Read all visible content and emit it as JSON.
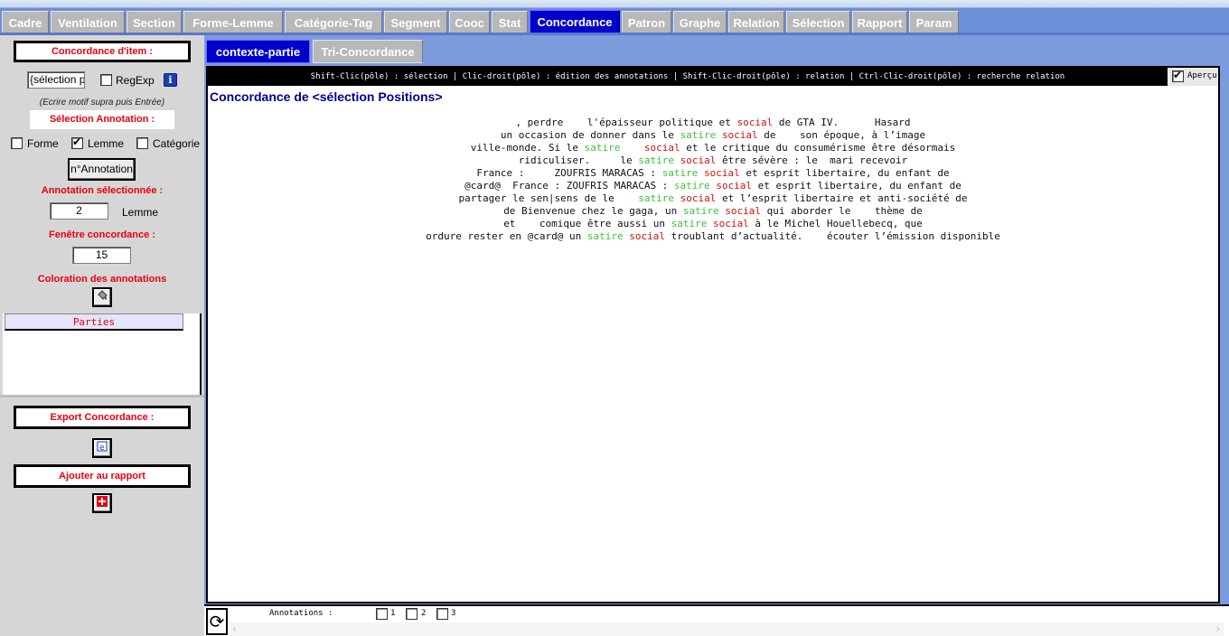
{
  "tabs": [
    {
      "label": "Cadre",
      "active": false
    },
    {
      "label": "Ventilation",
      "active": false
    },
    {
      "label": "Section",
      "active": false
    },
    {
      "label": "Forme-Lemme",
      "active": false
    },
    {
      "label": "Catégorie-Tag",
      "active": false
    },
    {
      "label": "Segment",
      "active": false
    },
    {
      "label": "Cooc",
      "active": false
    },
    {
      "label": "Stat",
      "active": false
    },
    {
      "label": "Concordance",
      "active": true
    },
    {
      "label": "Patron",
      "active": false
    },
    {
      "label": "Graphe",
      "active": false
    },
    {
      "label": "Relation",
      "active": false
    },
    {
      "label": "Sélection",
      "active": false
    },
    {
      "label": "Rapport",
      "active": false
    },
    {
      "label": "Param",
      "active": false
    }
  ],
  "left_panel": {
    "concordance_item_label": "Concordance d'item :",
    "search_value": "{sélection po",
    "regexp_label": "RegExp",
    "regexp_checked": false,
    "info_icon": "i",
    "hint": "(Ecrire motif supra puis Entrée)",
    "selection_annotation_label": "Sélection Annotation :",
    "annotation_types": [
      {
        "label": "Forme",
        "checked": false
      },
      {
        "label": "Lemme",
        "checked": true
      },
      {
        "label": "Catégorie",
        "checked": false
      }
    ],
    "n_annotation_button": "n°Annotation",
    "annotation_selected_label": "Annotation sélectionnée :",
    "annotation_selected_value": "2",
    "annotation_selected_name": "Lemme",
    "window_label": "Fenêtre concordance :",
    "window_value": "15",
    "coloring_label": "Coloration des annotations",
    "parties_header": "Parties",
    "export_label": "Export Concordance :",
    "add_report_label": "Ajouter au rapport"
  },
  "subtabs": [
    {
      "label": "contexte-partie",
      "active": true
    },
    {
      "label": "Tri-Concordance",
      "active": false
    }
  ],
  "content": {
    "instructions": "Shift-Clic(pôle) : sélection | Clic-droit(pôle) : édition des annotations | Shift-Clic-droit(pôle) : relation | Ctrl-Clic-droit(pôle) : recherche relation",
    "apercu_label": "Aperçu",
    "apercu_checked": true,
    "title": "Concordance de <sélection Positions>",
    "lines": [
      [
        {
          "t": ", perdre    l'épaisseur politique et ",
          "c": "n"
        },
        {
          "t": "social",
          "c": "k"
        },
        {
          "t": " de GTA IV.      Hasard",
          "c": "n"
        }
      ],
      [
        {
          "t": "un occasion de donner dans le ",
          "c": "n"
        },
        {
          "t": "satire",
          "c": "p"
        },
        {
          "t": " ",
          "c": "n"
        },
        {
          "t": "social",
          "c": "k"
        },
        {
          "t": " de    son époque, à l’image",
          "c": "n"
        }
      ],
      [
        {
          "t": "ville-monde. Si le ",
          "c": "n"
        },
        {
          "t": "satire",
          "c": "p"
        },
        {
          "t": "    ",
          "c": "n"
        },
        {
          "t": "social",
          "c": "k"
        },
        {
          "t": " et le critique du consumérisme être désormais",
          "c": "n"
        }
      ],
      [
        {
          "t": "ridiculiser.     le ",
          "c": "n"
        },
        {
          "t": "satire",
          "c": "p"
        },
        {
          "t": " ",
          "c": "n"
        },
        {
          "t": "social",
          "c": "k"
        },
        {
          "t": " être sévère : le  mari recevoir",
          "c": "n"
        }
      ],
      [
        {
          "t": "France :     ZOUFRIS MARACAS : ",
          "c": "n"
        },
        {
          "t": "satire",
          "c": "p"
        },
        {
          "t": " ",
          "c": "n"
        },
        {
          "t": "social",
          "c": "k"
        },
        {
          "t": " et esprit libertaire, du enfant de",
          "c": "n"
        }
      ],
      [
        {
          "t": "@card@  France : ZOUFRIS MARACAS : ",
          "c": "n"
        },
        {
          "t": "satire",
          "c": "p"
        },
        {
          "t": " ",
          "c": "n"
        },
        {
          "t": "social",
          "c": "k"
        },
        {
          "t": " et esprit libertaire, du enfant de",
          "c": "n"
        }
      ],
      [
        {
          "t": "partager le sen|sens de le    ",
          "c": "n"
        },
        {
          "t": "satire",
          "c": "p"
        },
        {
          "t": " ",
          "c": "n"
        },
        {
          "t": "social",
          "c": "k"
        },
        {
          "t": " et l’esprit libertaire et anti-société de",
          "c": "n"
        }
      ],
      [
        {
          "t": "de Bienvenue chez le gaga, un ",
          "c": "n"
        },
        {
          "t": "satire",
          "c": "p"
        },
        {
          "t": " ",
          "c": "n"
        },
        {
          "t": "social",
          "c": "k"
        },
        {
          "t": " qui aborder le    thème de",
          "c": "n"
        }
      ],
      [
        {
          "t": "et    comique être aussi un ",
          "c": "n"
        },
        {
          "t": "satire",
          "c": "p"
        },
        {
          "t": " ",
          "c": "n"
        },
        {
          "t": "social",
          "c": "k"
        },
        {
          "t": " à le Michel Houellebecq, que",
          "c": "n"
        }
      ],
      [
        {
          "t": "ordure rester en @card@ un ",
          "c": "n"
        },
        {
          "t": "satire",
          "c": "p"
        },
        {
          "t": " ",
          "c": "n"
        },
        {
          "t": "social",
          "c": "k"
        },
        {
          "t": " troublant d’actualité.    écouter l’émission disponible",
          "c": "n"
        }
      ]
    ]
  },
  "bottom": {
    "annotations_label": "Annotations :",
    "annotation_boxes": [
      "1",
      "2",
      "3"
    ]
  }
}
